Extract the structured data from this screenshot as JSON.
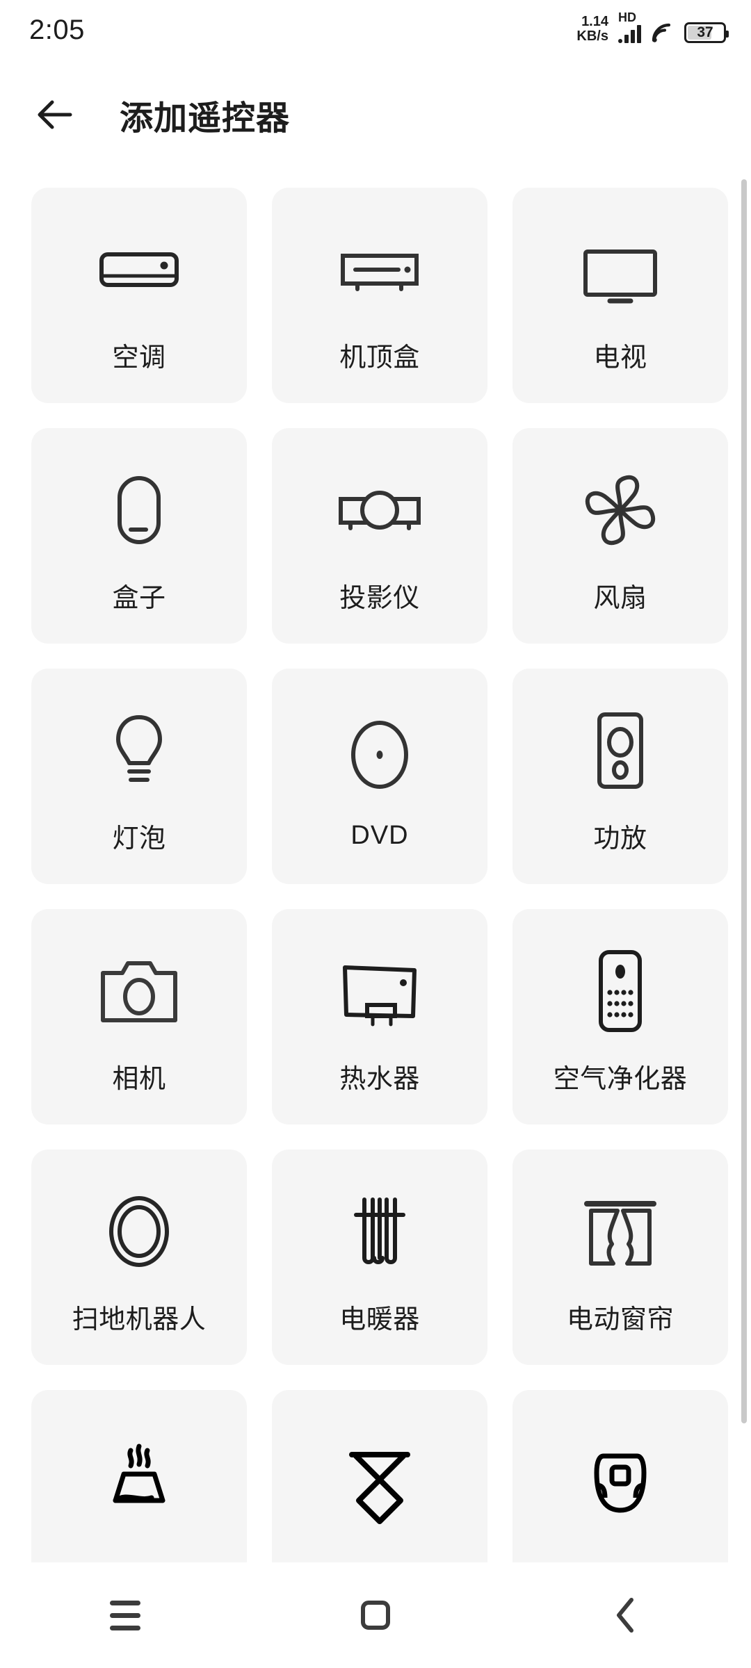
{
  "status_bar": {
    "clock": "2:05",
    "net_speed_value": "1.14",
    "net_speed_unit": "KB/s",
    "network_type": "HD",
    "signal_icon": "signal-bars-icon",
    "wifi_icon": "wifi-icon",
    "battery_level": "37"
  },
  "header": {
    "back_icon": "arrow-left-icon",
    "title": "添加遥控器"
  },
  "grid": {
    "cards": [
      {
        "label": "空调",
        "icon": "air-conditioner-icon"
      },
      {
        "label": "机顶盒",
        "icon": "set-top-box-icon"
      },
      {
        "label": "电视",
        "icon": "television-icon"
      },
      {
        "label": "盒子",
        "icon": "tv-box-icon"
      },
      {
        "label": "投影仪",
        "icon": "projector-icon"
      },
      {
        "label": "风扇",
        "icon": "fan-icon"
      },
      {
        "label": "灯泡",
        "icon": "light-bulb-icon"
      },
      {
        "label": "DVD",
        "icon": "dvd-disc-icon"
      },
      {
        "label": "功放",
        "icon": "amplifier-icon"
      },
      {
        "label": "相机",
        "icon": "camera-icon"
      },
      {
        "label": "热水器",
        "icon": "water-heater-icon"
      },
      {
        "label": "空气净化器",
        "icon": "air-purifier-icon"
      },
      {
        "label": "扫地机器人",
        "icon": "robot-vacuum-icon"
      },
      {
        "label": "电暖器",
        "icon": "radiator-heater-icon"
      },
      {
        "label": "电动窗帘",
        "icon": "curtain-icon"
      },
      {
        "label": "",
        "icon": "steam-cooker-icon"
      },
      {
        "label": "",
        "icon": "hourglass-icon"
      },
      {
        "label": "",
        "icon": "humidifier-icon"
      }
    ]
  },
  "nav_bar": {
    "recents_icon": "hamburger-menu-icon",
    "home_icon": "home-square-icon",
    "back_icon": "chevron-left-icon"
  },
  "colors": {
    "background": "#ffffff",
    "card_background": "#f5f5f5",
    "text_primary": "#1d1d1d",
    "icon_stroke": "#333333",
    "scrollbar": "#c9c9c9",
    "nav_icon": "#3c3c3c"
  }
}
